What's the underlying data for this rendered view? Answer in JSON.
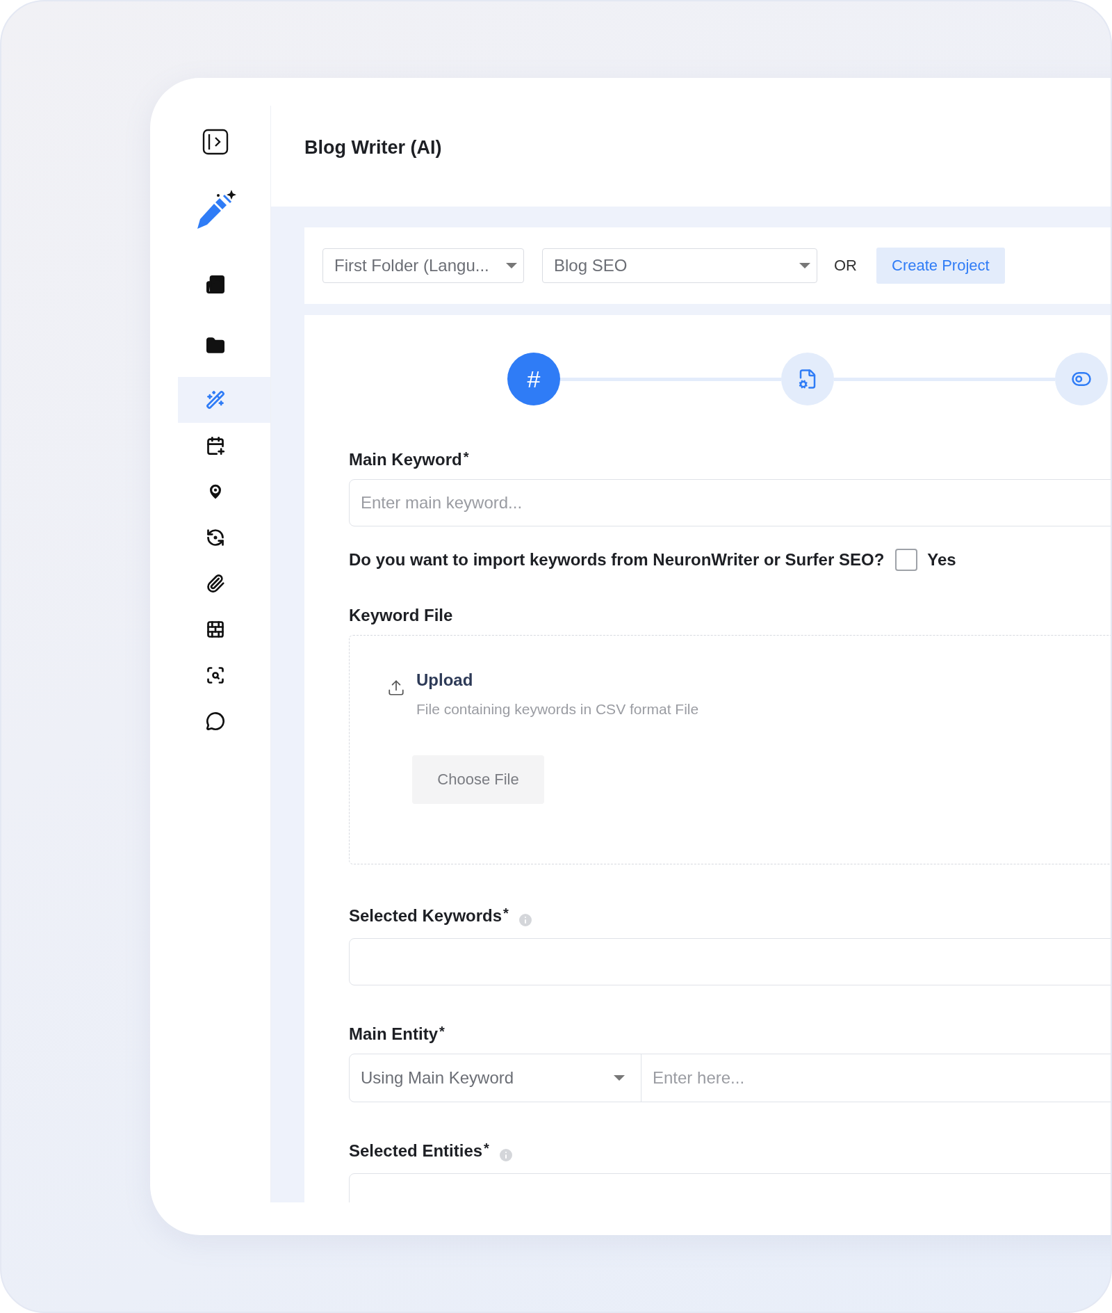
{
  "sidebar": {
    "items": [
      {
        "selected": false
      },
      {
        "selected": false
      },
      {
        "selected": false
      },
      {
        "selected": false
      },
      {
        "selected": true
      },
      {
        "selected": false
      },
      {
        "selected": false
      },
      {
        "selected": false
      },
      {
        "selected": false
      },
      {
        "selected": false
      },
      {
        "selected": false
      },
      {
        "selected": false
      }
    ]
  },
  "header": {
    "title": "Blog Writer (AI)"
  },
  "toolbar": {
    "folder_select": {
      "value": "First Folder (Langu..."
    },
    "project_select": {
      "value": "Blog SEO"
    },
    "separator": "OR",
    "create_button": "Create Project"
  },
  "stepper": {
    "steps": [
      {
        "symbol": "#",
        "selected": true
      },
      {
        "selected": false
      },
      {
        "selected": false
      }
    ]
  },
  "form": {
    "required_mark": "*",
    "main_keyword": {
      "label": "Main Keyword",
      "required": true,
      "placeholder": "Enter main keyword..."
    },
    "import_question": {
      "label": "Do you want to import keywords from NeuronWriter or Surfer SEO?",
      "checked": false,
      "option": "Yes"
    },
    "keyword_file": {
      "label": "Keyword File",
      "upload_title": "Upload",
      "upload_hint": "File containing keywords in CSV format File",
      "button": "Choose File"
    },
    "selected_keywords": {
      "label": "Selected Keywords",
      "required": true,
      "info": true
    },
    "main_entity": {
      "label": "Main Entity",
      "required": true,
      "select_value": "Using Main Keyword",
      "placeholder": "Enter here..."
    },
    "selected_entities": {
      "label": "Selected Entities",
      "required": true,
      "info": true
    }
  }
}
